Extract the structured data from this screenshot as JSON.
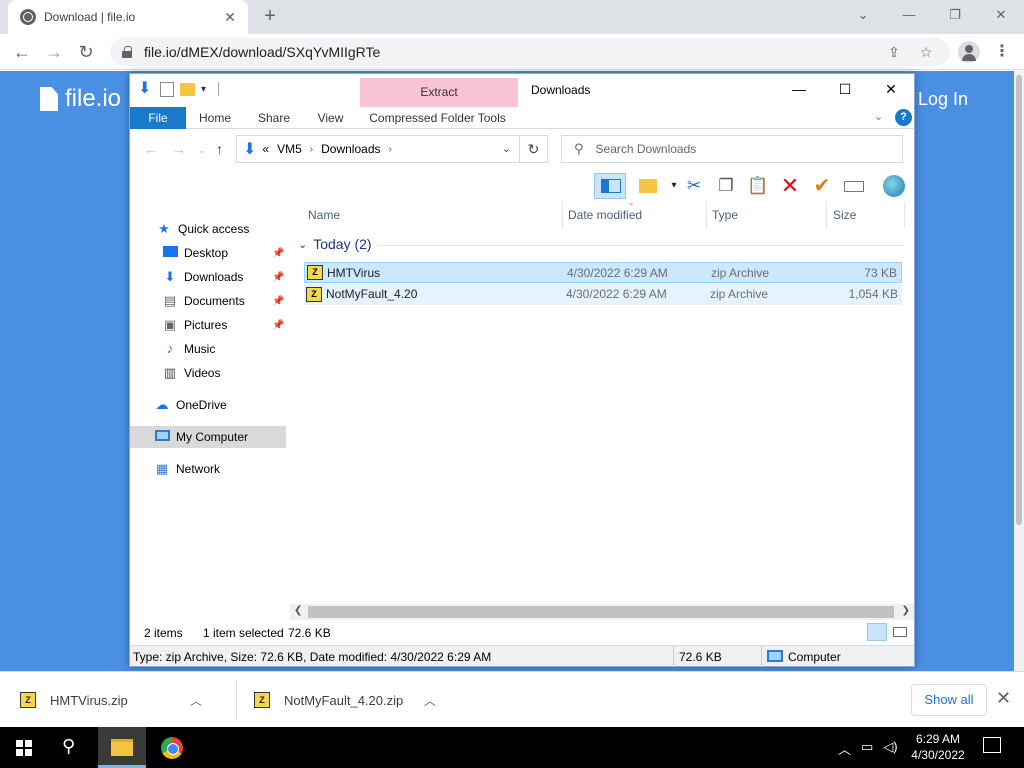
{
  "browser": {
    "tab_title": "Download | file.io",
    "url": "file.io/dMEX/download/SXqYvMIIgRTe"
  },
  "page": {
    "logo_text": "file.io",
    "login_label": "Log In"
  },
  "explorer": {
    "window_title": "Downloads",
    "contextual_tab": "Extract",
    "ribbon_tabs": {
      "file": "File",
      "home": "Home",
      "share": "Share",
      "view": "View",
      "compressed": "Compressed Folder Tools"
    },
    "breadcrumb": {
      "prefix": "«",
      "parts": [
        "VM5",
        "Downloads"
      ]
    },
    "search_placeholder": "Search Downloads",
    "nav": {
      "quick_access": "Quick access",
      "desktop": "Desktop",
      "downloads": "Downloads",
      "documents": "Documents",
      "pictures": "Pictures",
      "music": "Music",
      "videos": "Videos",
      "onedrive": "OneDrive",
      "my_computer": "My Computer",
      "network": "Network"
    },
    "columns": {
      "name": "Name",
      "date": "Date modified",
      "type": "Type",
      "size": "Size"
    },
    "group_label": "Today (2)",
    "files": [
      {
        "name": "HMTVirus",
        "date": "4/30/2022 6:29 AM",
        "type": "zip Archive",
        "size": "73 KB"
      },
      {
        "name": "NotMyFault_4.20",
        "date": "4/30/2022 6:29 AM",
        "type": "zip Archive",
        "size": "1,054 KB"
      }
    ],
    "status": {
      "items": "2 items",
      "selected": "1 item selected",
      "selected_size": "72.6 KB"
    },
    "details_bar": {
      "text": "Type: zip Archive, Size: 72.6 KB, Date modified: 4/30/2022 6:29 AM",
      "size": "72.6 KB",
      "location": "Computer"
    }
  },
  "downloads_shelf": {
    "items": [
      "HMTVirus.zip",
      "NotMyFault_4.20.zip"
    ],
    "show_all": "Show all"
  },
  "taskbar": {
    "time": "6:29 AM",
    "date": "4/30/2022"
  },
  "colors": {
    "page_blue": "#4a90e2",
    "file_tab_blue": "#1979ca",
    "extract_pink": "#f9c3d6",
    "selection": "#cce8ff"
  }
}
